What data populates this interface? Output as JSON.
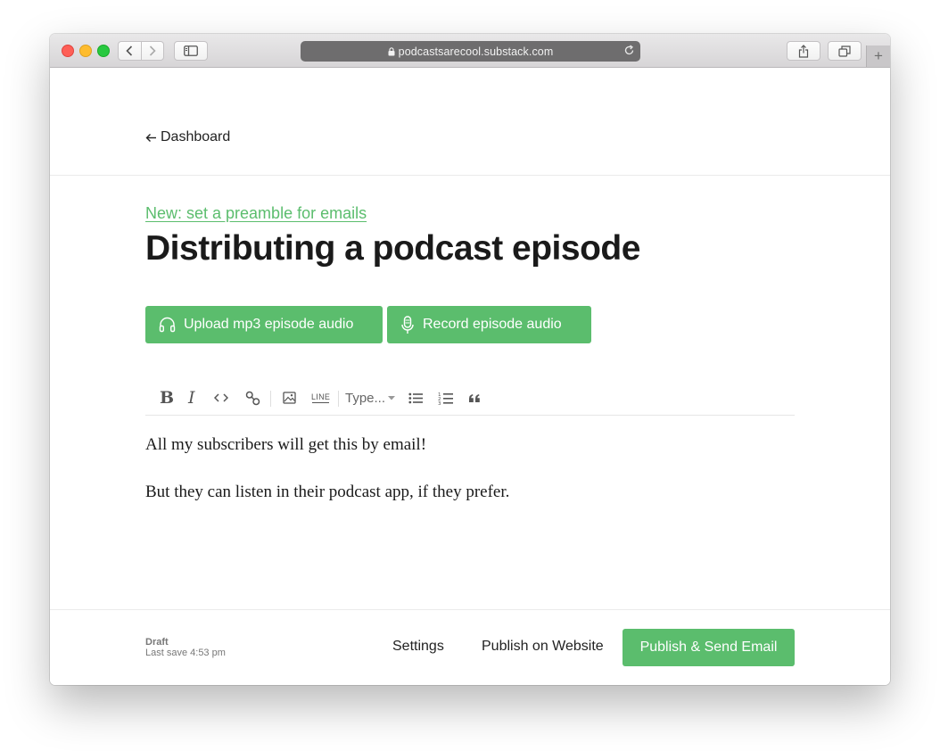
{
  "browser": {
    "url": "podcastsarecool.substack.com",
    "new_tab": "+"
  },
  "page": {
    "back_label": "Dashboard",
    "preamble_link": "New: set a preamble for emails",
    "title": "Distributing a podcast episode",
    "upload_button": "Upload mp3 episode audio",
    "record_button": "Record episode audio"
  },
  "toolbar": {
    "bold": "B",
    "italic": "I",
    "line": "LINE",
    "type_select": "Type..."
  },
  "editor": {
    "paragraphs": [
      "All my subscribers will get this by email!",
      "But they can listen in their podcast app, if they prefer."
    ]
  },
  "footer": {
    "status": "Draft",
    "last_save": "Last save 4:53 pm",
    "settings": "Settings",
    "publish_web": "Publish on Website",
    "publish_email": "Publish & Send Email"
  },
  "colors": {
    "accent_green": "#5bbd6d",
    "address_bar": "#6e6d6e"
  },
  "icons": [
    "lock-icon",
    "reload-icon",
    "share-icon",
    "tabs-icon",
    "sidebar-icon",
    "back-arrow-icon",
    "headphones-icon",
    "microphone-icon",
    "code-icon",
    "link-icon",
    "image-icon",
    "bullet-list-icon",
    "numbered-list-icon",
    "quote-icon"
  ]
}
